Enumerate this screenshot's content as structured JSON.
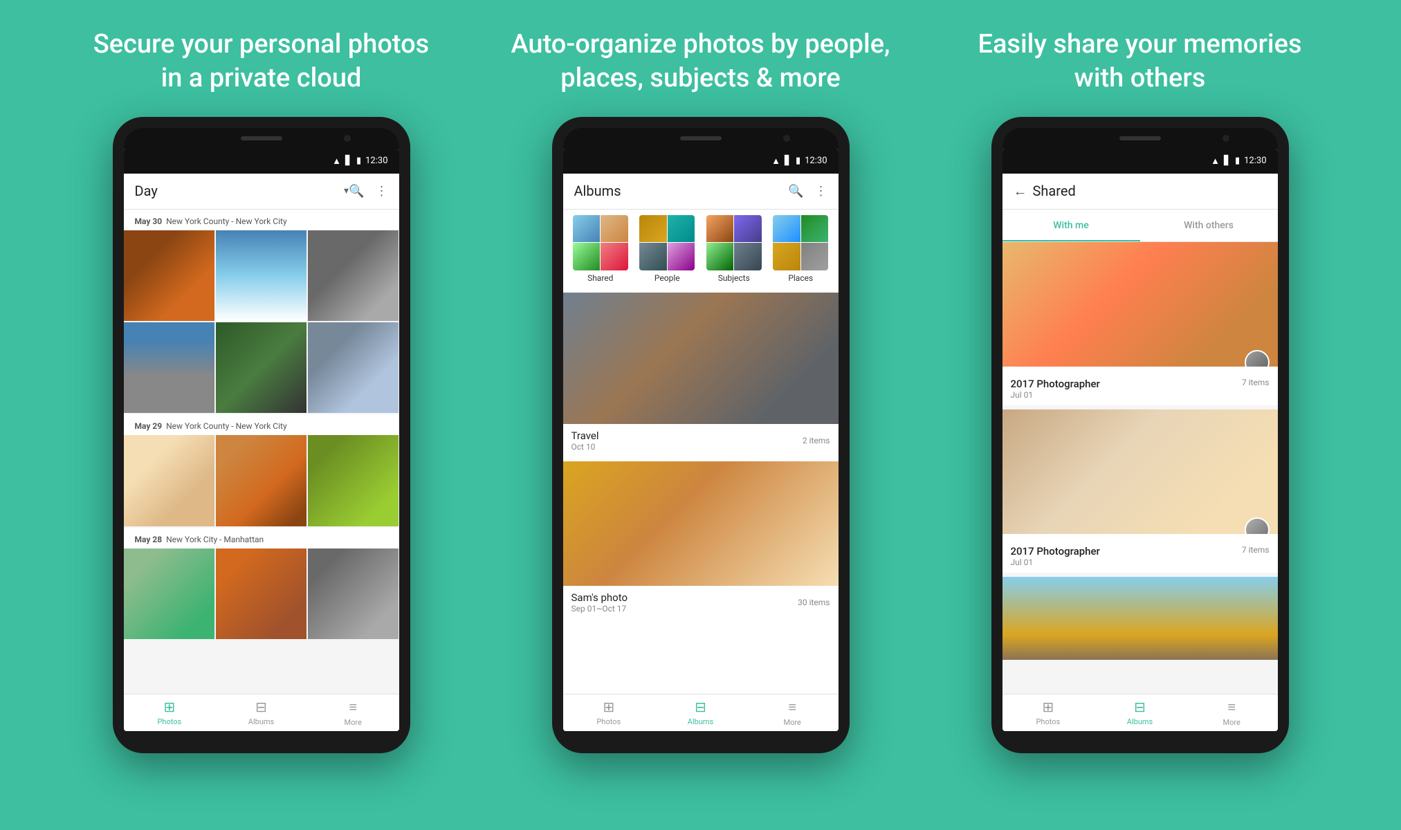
{
  "background_color": "#3dbfa0",
  "headers": [
    {
      "id": "header1",
      "text": "Secure your personal photos\nin a private cloud"
    },
    {
      "id": "header2",
      "text": "Auto-organize photos by people,\nplaces, subjects & more"
    },
    {
      "id": "header3",
      "text": "Easily share your memories\nwith others"
    }
  ],
  "phone1": {
    "status_time": "12:30",
    "app_bar_title": "Day",
    "sections": [
      {
        "date": "May 30",
        "location": "New York County - New York City"
      },
      {
        "date": "May 29",
        "location": "New York County - New York City"
      },
      {
        "date": "May 28",
        "location": "New York City - Manhattan"
      }
    ],
    "nav": [
      "Photos",
      "Albums",
      "More"
    ]
  },
  "phone2": {
    "status_time": "12:30",
    "app_bar_title": "Albums",
    "categories": [
      "Shared",
      "People",
      "Subjects",
      "Places"
    ],
    "albums": [
      {
        "name": "Travel",
        "date": "Oct 10",
        "count": "2 items"
      },
      {
        "name": "Sam's photo",
        "date": "Sep 01~Oct 17",
        "count": "30 items"
      }
    ],
    "nav": [
      "Photos",
      "Albums",
      "More"
    ]
  },
  "phone3": {
    "status_time": "12:30",
    "app_bar_title": "Shared",
    "back_label": "←",
    "tabs": [
      "With me",
      "With others"
    ],
    "active_tab": "With me",
    "shared_albums": [
      {
        "name": "2017 Photographer",
        "date": "Jul 01",
        "count": "7 items"
      },
      {
        "name": "2017 Photographer",
        "date": "Jul 01",
        "count": "7 items"
      }
    ],
    "nav": [
      "Photos",
      "Albums",
      "More"
    ]
  }
}
